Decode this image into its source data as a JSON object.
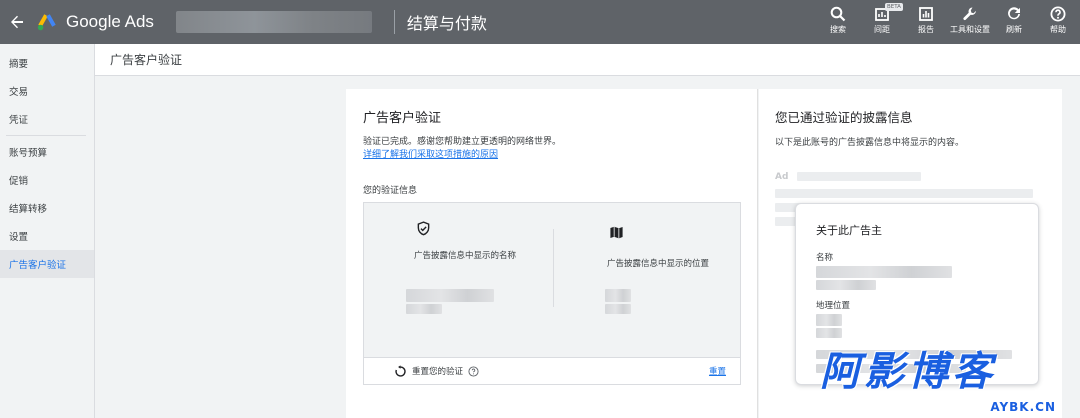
{
  "topbar": {
    "brand": "Google Ads",
    "page_heading": "结算与付款",
    "tools": [
      {
        "icon": "search-icon",
        "label": "搜索"
      },
      {
        "icon": "report-icon",
        "label": "间距",
        "badge": "BETA"
      },
      {
        "icon": "chart-icon",
        "label": "报告"
      },
      {
        "icon": "wrench-icon",
        "label": "工具和设置"
      },
      {
        "icon": "refresh-icon",
        "label": "刷新"
      },
      {
        "icon": "help-icon",
        "label": "帮助"
      }
    ]
  },
  "sidebar": {
    "items": [
      {
        "label": "摘要"
      },
      {
        "label": "交易"
      },
      {
        "label": "凭证"
      },
      {
        "label": "账号预算"
      },
      {
        "label": "促销"
      },
      {
        "label": "结算转移"
      },
      {
        "label": "设置"
      },
      {
        "label": "广告客户验证"
      }
    ],
    "active_index": 7
  },
  "page_title": "广告客户验证",
  "verification": {
    "title": "广告客户验证",
    "description": "验证已完成。感谢您帮助建立更透明的网络世界。",
    "learn_more": "详细了解我们采取这项措施的原因",
    "info_label": "您的验证信息",
    "name_item": "广告披露信息中显示的名称",
    "location_item": "广告披露信息中显示的位置",
    "reset_text": "重置您的验证",
    "reset_link": "重置"
  },
  "disclosure": {
    "title": "您已通过验证的披露信息",
    "description": "以下是此账号的广告披露信息中将显示的内容。",
    "ad_tag": "Ad",
    "card_title": "关于此广告主",
    "name_label": "名称",
    "location_label": "地理位置"
  },
  "watermark": {
    "cn": "阿影博客",
    "en": "AYBK.CN"
  },
  "colors": {
    "topbar": "#5f6368",
    "link": "#1a73e8",
    "watermark": "#1a5fe0"
  }
}
